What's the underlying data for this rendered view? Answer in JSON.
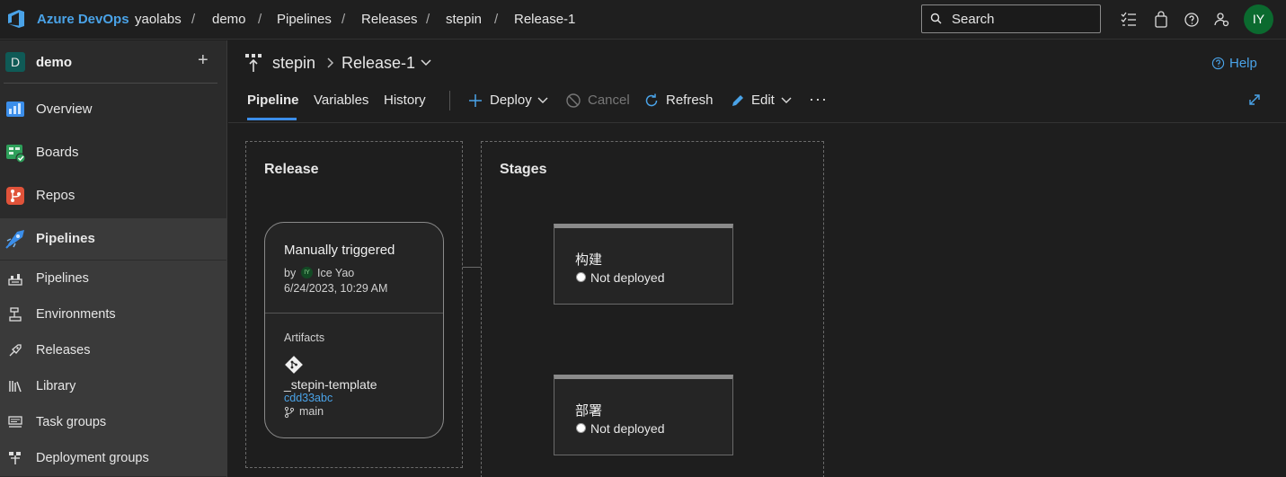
{
  "topbar": {
    "brand": "Azure DevOps",
    "breadcrumbs": [
      "yaolabs",
      "demo",
      "Pipelines",
      "Releases",
      "stepin",
      "Release-1"
    ],
    "separator": "/",
    "search_placeholder": "Search",
    "avatar_initials": "IY"
  },
  "sidebar": {
    "project_initial": "D",
    "project_name": "demo",
    "add_label": "+",
    "items": [
      {
        "label": "Overview",
        "icon": "overview-icon"
      },
      {
        "label": "Boards",
        "icon": "boards-icon"
      },
      {
        "label": "Repos",
        "icon": "repos-icon"
      },
      {
        "label": "Pipelines",
        "icon": "pipelines-icon"
      }
    ],
    "sub_items": [
      {
        "label": "Pipelines",
        "icon": "pipelines-sub-icon"
      },
      {
        "label": "Environments",
        "icon": "environments-icon"
      },
      {
        "label": "Releases",
        "icon": "releases-icon"
      },
      {
        "label": "Library",
        "icon": "library-icon"
      },
      {
        "label": "Task groups",
        "icon": "task-groups-icon"
      },
      {
        "label": "Deployment groups",
        "icon": "deployment-groups-icon"
      }
    ]
  },
  "header": {
    "pipeline_name": "stepin",
    "release_name": "Release-1",
    "help_label": "Help"
  },
  "tabs": {
    "pipeline": "Pipeline",
    "variables": "Variables",
    "history": "History"
  },
  "toolbar": {
    "deploy": "Deploy",
    "cancel": "Cancel",
    "refresh": "Refresh",
    "edit": "Edit",
    "more": "···"
  },
  "release_section": {
    "title": "Release",
    "trigger": "Manually triggered",
    "by_label": "by",
    "user_initials": "IY",
    "user": "Ice Yao",
    "date": "6/24/2023, 10:29 AM",
    "artifacts_label": "Artifacts",
    "artifact_name": "_stepin-template",
    "commit": "cdd33abc",
    "branch": "main"
  },
  "stages_section": {
    "title": "Stages",
    "stages": [
      {
        "name": "构建",
        "status": "Not deployed"
      },
      {
        "name": "部署",
        "status": "Not deployed"
      }
    ]
  },
  "colors": {
    "accent": "#4aa3e8",
    "tab_underline": "#3b8eea",
    "avatar_bg": "#0b6a2f"
  }
}
